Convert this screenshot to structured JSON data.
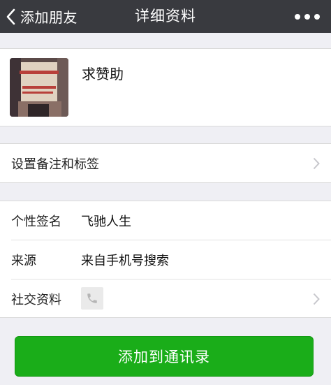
{
  "navbar": {
    "back_label": "添加朋友",
    "title": "详细资料"
  },
  "profile": {
    "name": "求赞助",
    "avatar_text": "求赞助"
  },
  "rows": {
    "remark": {
      "label": "设置备注和标签"
    },
    "signature": {
      "label": "个性签名",
      "value": "飞驰人生"
    },
    "source": {
      "label": "来源",
      "value": "来自手机号搜索"
    },
    "social": {
      "label": "社交资料",
      "icon": "phone-icon"
    }
  },
  "actions": {
    "add_contact_label": "添加到通讯录"
  },
  "colors": {
    "navbar_bg": "#393a3f",
    "page_bg": "#efeff4",
    "primary_button": "#1aad19"
  }
}
